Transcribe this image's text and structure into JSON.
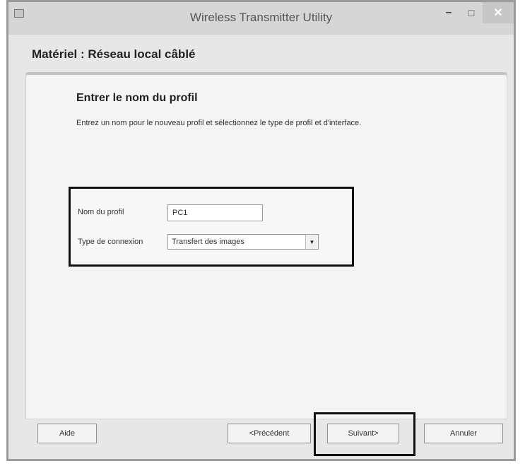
{
  "window": {
    "title": "Wireless Transmitter Utility",
    "minimize_glyph": "–",
    "maximize_glyph": "□",
    "close_glyph": "✕"
  },
  "header": {
    "label": "Matériel : Réseau local câblé"
  },
  "content": {
    "section_title": "Entrer le nom du profil",
    "description": "Entrez un nom pour le nouveau profil et sélectionnez le type de profil et d'interface."
  },
  "form": {
    "profile_name_label": "Nom du profil",
    "profile_name_value": "PC1",
    "connection_type_label": "Type de connexion",
    "connection_type_value": "Transfert des images"
  },
  "footer": {
    "help_label": "Aide",
    "previous_label": "<Précédent",
    "next_label": "Suivant>",
    "cancel_label": "Annuler"
  },
  "icons": {
    "dropdown": "chevron-down-icon",
    "app": "app-icon"
  }
}
